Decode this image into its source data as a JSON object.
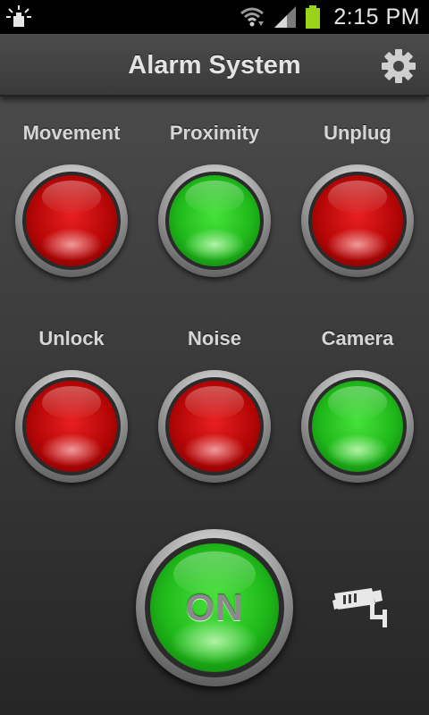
{
  "status_bar": {
    "time": "2:15 PM",
    "icons": [
      "notification-icon",
      "wifi-icon",
      "signal-icon",
      "battery-icon"
    ],
    "battery_color": "#9bd21c"
  },
  "header": {
    "title": "Alarm System",
    "settings_icon": "gear-icon"
  },
  "sensors": [
    {
      "id": "movement",
      "label": "Movement",
      "state_color": "red"
    },
    {
      "id": "proximity",
      "label": "Proximity",
      "state_color": "green"
    },
    {
      "id": "unplug",
      "label": "Unplug",
      "state_color": "red"
    },
    {
      "id": "unlock",
      "label": "Unlock",
      "state_color": "red"
    },
    {
      "id": "noise",
      "label": "Noise",
      "state_color": "red"
    },
    {
      "id": "camera",
      "label": "Camera",
      "state_color": "green"
    }
  ],
  "power_button": {
    "label": "ON",
    "state_color": "green"
  },
  "camera_icon": "security-camera-icon",
  "colors": {
    "red": "#c40a0a",
    "green": "#22c01c",
    "header_bg": "#444444"
  }
}
